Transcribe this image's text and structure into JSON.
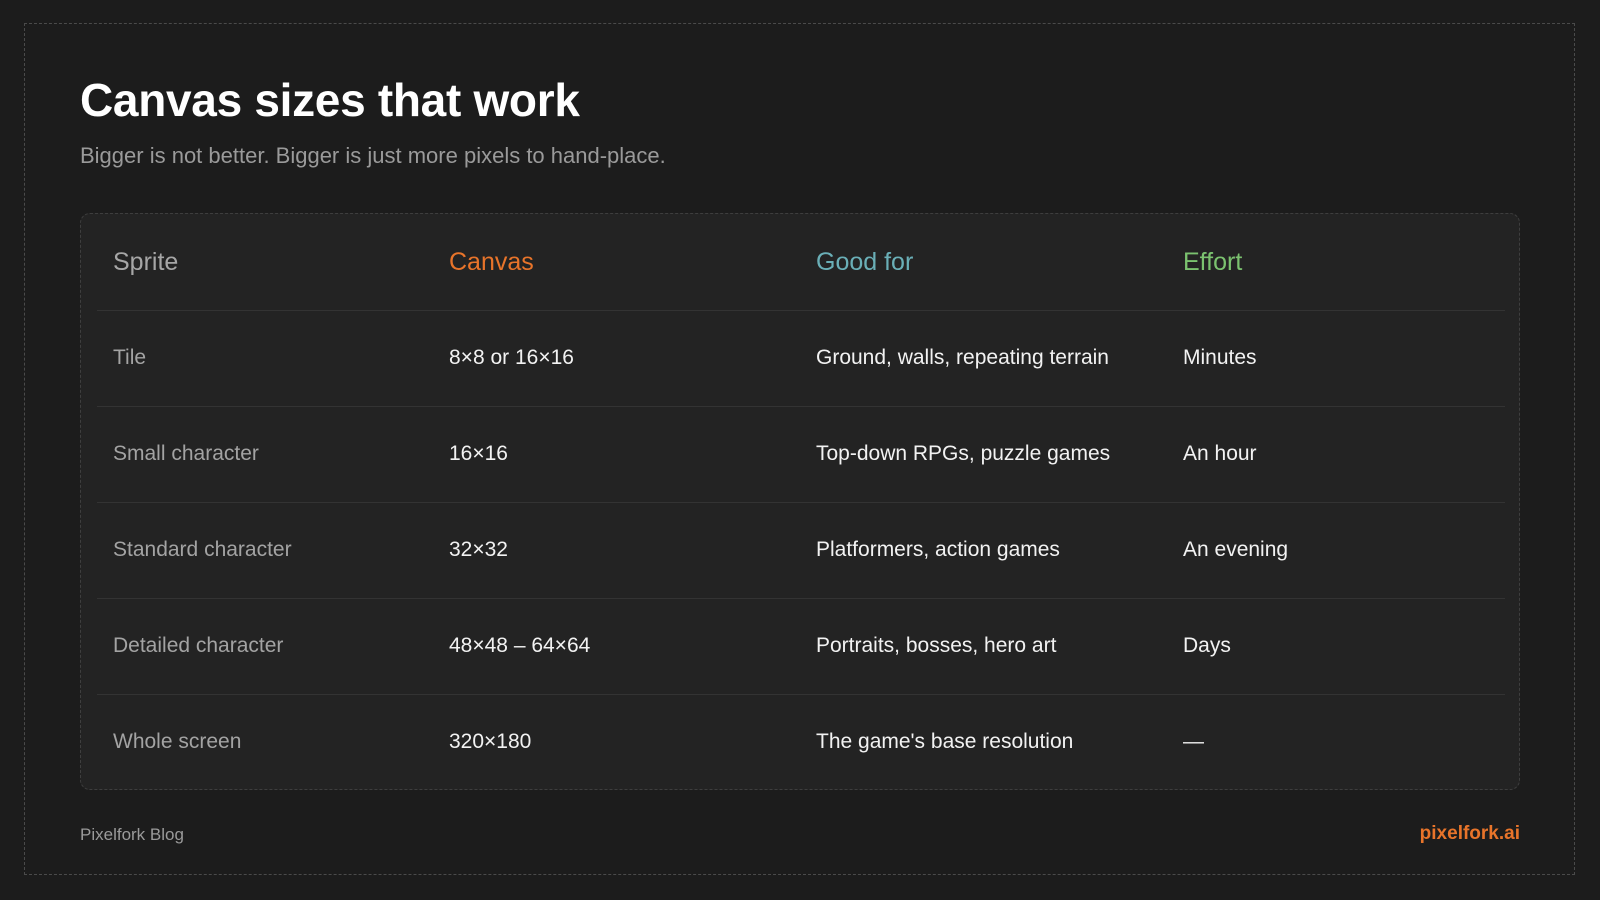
{
  "title": "Canvas sizes that work",
  "subtitle": "Bigger is not better. Bigger is just more pixels to hand-place.",
  "colors": {
    "canvas_header": "#e8742a",
    "good_for_header": "#6aafb7",
    "effort_header": "#7bc26f",
    "brand": "#e8742a"
  },
  "table": {
    "headers": [
      "Sprite",
      "Canvas",
      "Good for",
      "Effort"
    ],
    "rows": [
      [
        "Tile",
        "8×8 or 16×16",
        "Ground, walls, repeating terrain",
        "Minutes"
      ],
      [
        "Small character",
        "16×16",
        "Top-down RPGs, puzzle games",
        "An hour"
      ],
      [
        "Standard character",
        "32×32",
        "Platformers, action games",
        "An evening"
      ],
      [
        "Detailed character",
        "48×48 – 64×64",
        "Portraits, bosses, hero art",
        "Days"
      ],
      [
        "Whole screen",
        "320×180",
        "The game's base resolution",
        "—"
      ]
    ]
  },
  "footer": {
    "left": "Pixelfork Blog",
    "right": "pixelfork.ai"
  }
}
